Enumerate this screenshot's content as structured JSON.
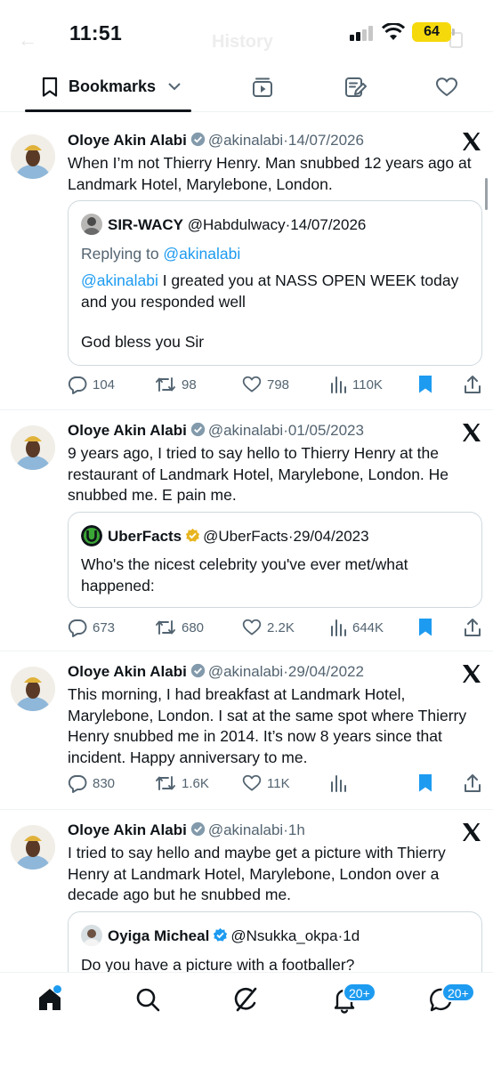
{
  "status_bar": {
    "time": "11:51",
    "battery": "64"
  },
  "underlay": {
    "title": "History"
  },
  "tabs": {
    "active_label": "Bookmarks"
  },
  "tweets": [
    {
      "name": "Oloye Akin Alabi",
      "handle": "@akinalabi",
      "date": "14/07/2026",
      "text": "When I’m not Thierry Henry. Man snubbed 12 years ago at Landmark Hotel, Marylebone, London.",
      "quote": {
        "name": "SIR-WACY",
        "handle": "@Habdulwacy",
        "date": "14/07/2026",
        "replying_prefix": "Replying to ",
        "replying_handle": "@akinalabi",
        "mention": "@akinalabi",
        "text": " I greated you at NASS OPEN WEEK today and you responded well",
        "text2": "God bless you Sir"
      },
      "stats": {
        "replies": "104",
        "reposts": "98",
        "likes": "798",
        "views": "110K"
      }
    },
    {
      "name": "Oloye Akin Alabi",
      "handle": "@akinalabi",
      "date": "01/05/2023",
      "text": "9 years ago, I tried to say hello to Thierry Henry at the restaurant of Landmark Hotel, Marylebone, London. He snubbed me. E pain me.",
      "quote": {
        "name": "UberFacts",
        "handle": "@UberFacts",
        "date": "29/04/2023",
        "text": "Who's the nicest celebrity you've ever met/what happened:"
      },
      "stats": {
        "replies": "673",
        "reposts": "680",
        "likes": "2.2K",
        "views": "644K"
      }
    },
    {
      "name": "Oloye Akin Alabi",
      "handle": "@akinalabi",
      "date": "29/04/2022",
      "text": "This morning, I had breakfast at Landmark Hotel, Marylebone, London. I sat at the same spot where Thierry Henry snubbed me in 2014. It’s now 8 years since that incident. Happy anniversary to me.",
      "stats": {
        "replies": "830",
        "reposts": "1.6K",
        "likes": "11K",
        "views": ""
      }
    },
    {
      "name": "Oloye Akin Alabi",
      "handle": "@akinalabi",
      "date": "1h",
      "text": "I tried to say hello and maybe get a picture with Thierry Henry at Landmark Hotel, Marylebone, London over a decade ago but he snubbed me.",
      "quote": {
        "name": "Oyiga Micheal",
        "handle": "@Nsukka_okpa",
        "date": "1d",
        "text": "Do you have a picture with a footballer?"
      }
    }
  ],
  "separator": "·",
  "nav": {
    "notifications_badge": "20+",
    "messages_badge": "20+"
  },
  "colors": {
    "accent": "#1d9bf0",
    "text": "#0f1419",
    "muted": "#536471",
    "border": "#cfd9de",
    "battery": "#f6d90b"
  }
}
